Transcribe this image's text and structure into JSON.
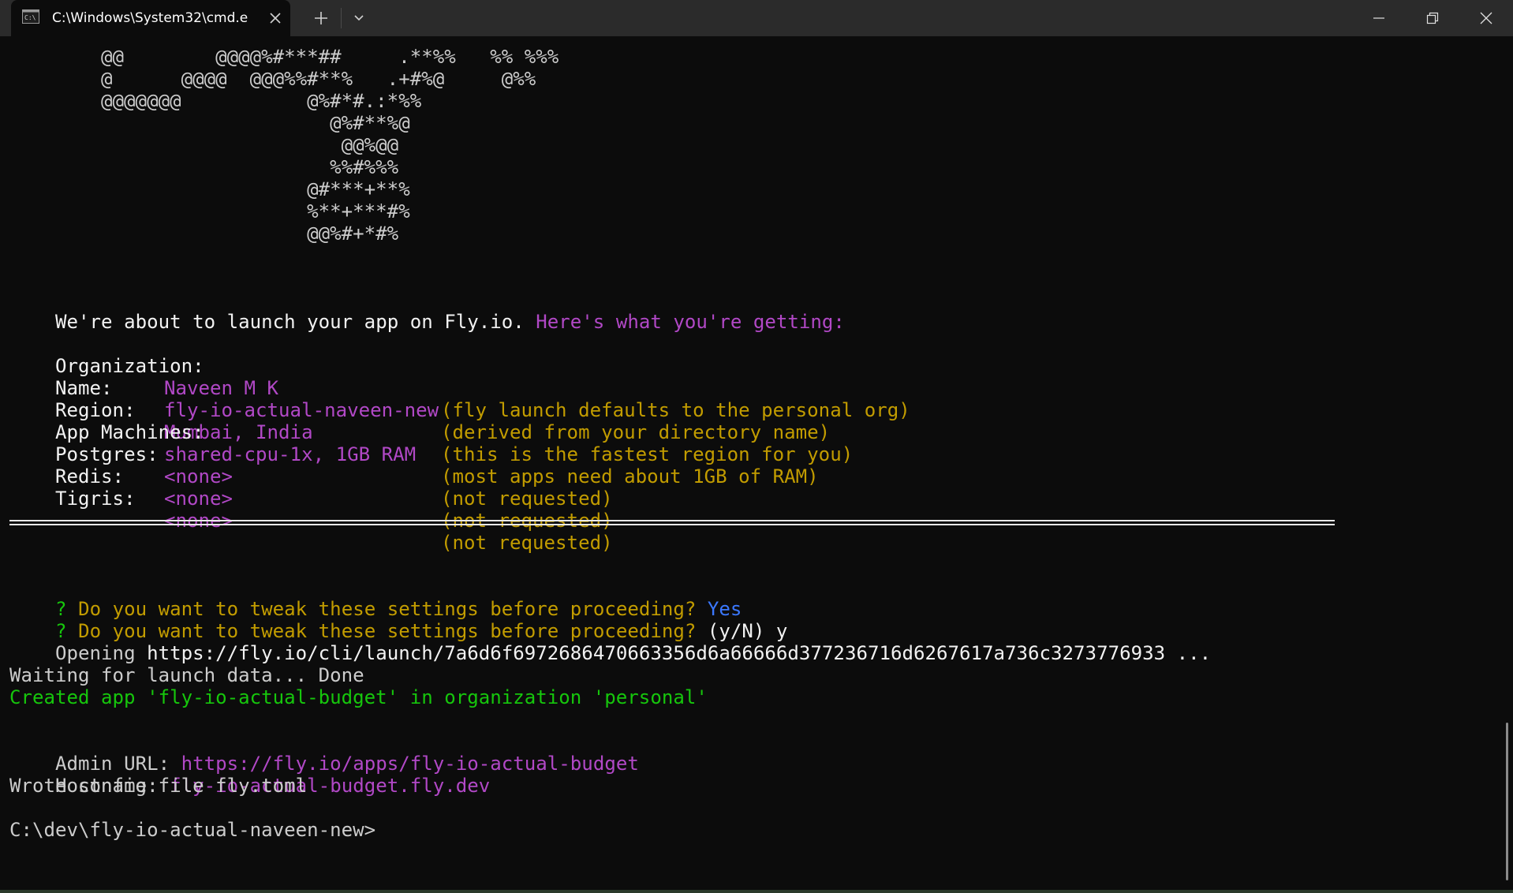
{
  "window": {
    "tab_title": "C:\\Windows\\System32\\cmd.e"
  },
  "ascii_art": [
    "        @@        @@@@%#***##     .**%%   %% %%%",
    "        @      @@@@  @@@%%#**%   .+#%@     @%%",
    "        @@@@@@@           @%#*#.:*%%",
    "                            @%#**%@",
    "                             @@%@@",
    "                            %%#%%%",
    "                          @#***+**%",
    "                          %**+***#%",
    "                          @@%#+*#%"
  ],
  "intro": {
    "text": "We're about to launch your app on Fly.io.",
    "highlight": "Here's what you're getting:"
  },
  "settings": [
    {
      "label": "Organization:",
      "value": "Naveen M K",
      "note": "(fly launch defaults to the personal org)"
    },
    {
      "label": "Name:",
      "value": "fly-io-actual-naveen-new",
      "note": "(derived from your directory name)"
    },
    {
      "label": "Region:",
      "value": "Mumbai, India",
      "note": "(this is the fastest region for you)"
    },
    {
      "label": "App Machines:",
      "value": "shared-cpu-1x, 1GB RAM",
      "note": "(most apps need about 1GB of RAM)"
    },
    {
      "label": "Postgres:",
      "value": "<none>",
      "note": "(not requested)"
    },
    {
      "label": "Redis:",
      "value": "<none>",
      "note": "(not requested)"
    },
    {
      "label": "Tigris:",
      "value": "<none>",
      "note": "(not requested)"
    }
  ],
  "prompt1": {
    "mark": "?",
    "question": "Do you want to tweak these settings before proceeding?",
    "answer": "Yes"
  },
  "prompt2": {
    "mark": "?",
    "question": "Do you want to tweak these settings before proceeding?",
    "answer": "(y/N) y"
  },
  "opening": {
    "label": "Opening",
    "url": "https://fly.io/cli/launch/7a6d6f6972686470663356d6a66666d377236716d6267617a736c3273776933",
    "suffix": "..."
  },
  "waiting": "Waiting for launch data... Done",
  "created": "Created app 'fly-io-actual-budget' in organization 'personal'",
  "admin": {
    "label": "Admin URL:",
    "url": "https://fly.io/apps/fly-io-actual-budget"
  },
  "hostname": {
    "label": "Hostname:",
    "value": "fly-io-actual-budget.fly.dev"
  },
  "wrote": "Wrote config file fly.toml",
  "cwd_prompt": "C:\\dev\\fly-io-actual-naveen-new>"
}
